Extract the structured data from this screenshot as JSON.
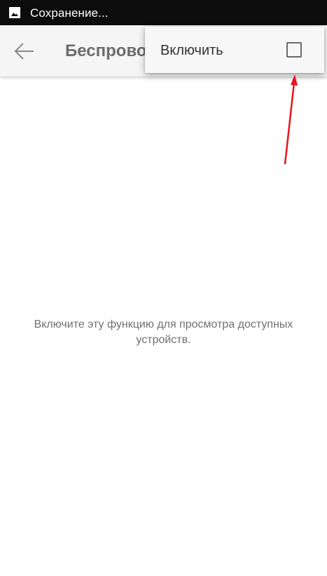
{
  "status_bar": {
    "text": "Сохранение...",
    "icon": "image-icon"
  },
  "toolbar": {
    "title": "Беспроводной дисплей",
    "back_icon": "arrow-left-icon"
  },
  "popup_menu": {
    "item_label": "Включить",
    "checked": false
  },
  "main": {
    "empty_message": "Включите эту функцию для просмотра доступных устройств."
  },
  "colors": {
    "status_bar_bg": "#0c0c0c",
    "toolbar_bg": "#f5f5f5",
    "annotation_arrow": "#e8141c"
  }
}
